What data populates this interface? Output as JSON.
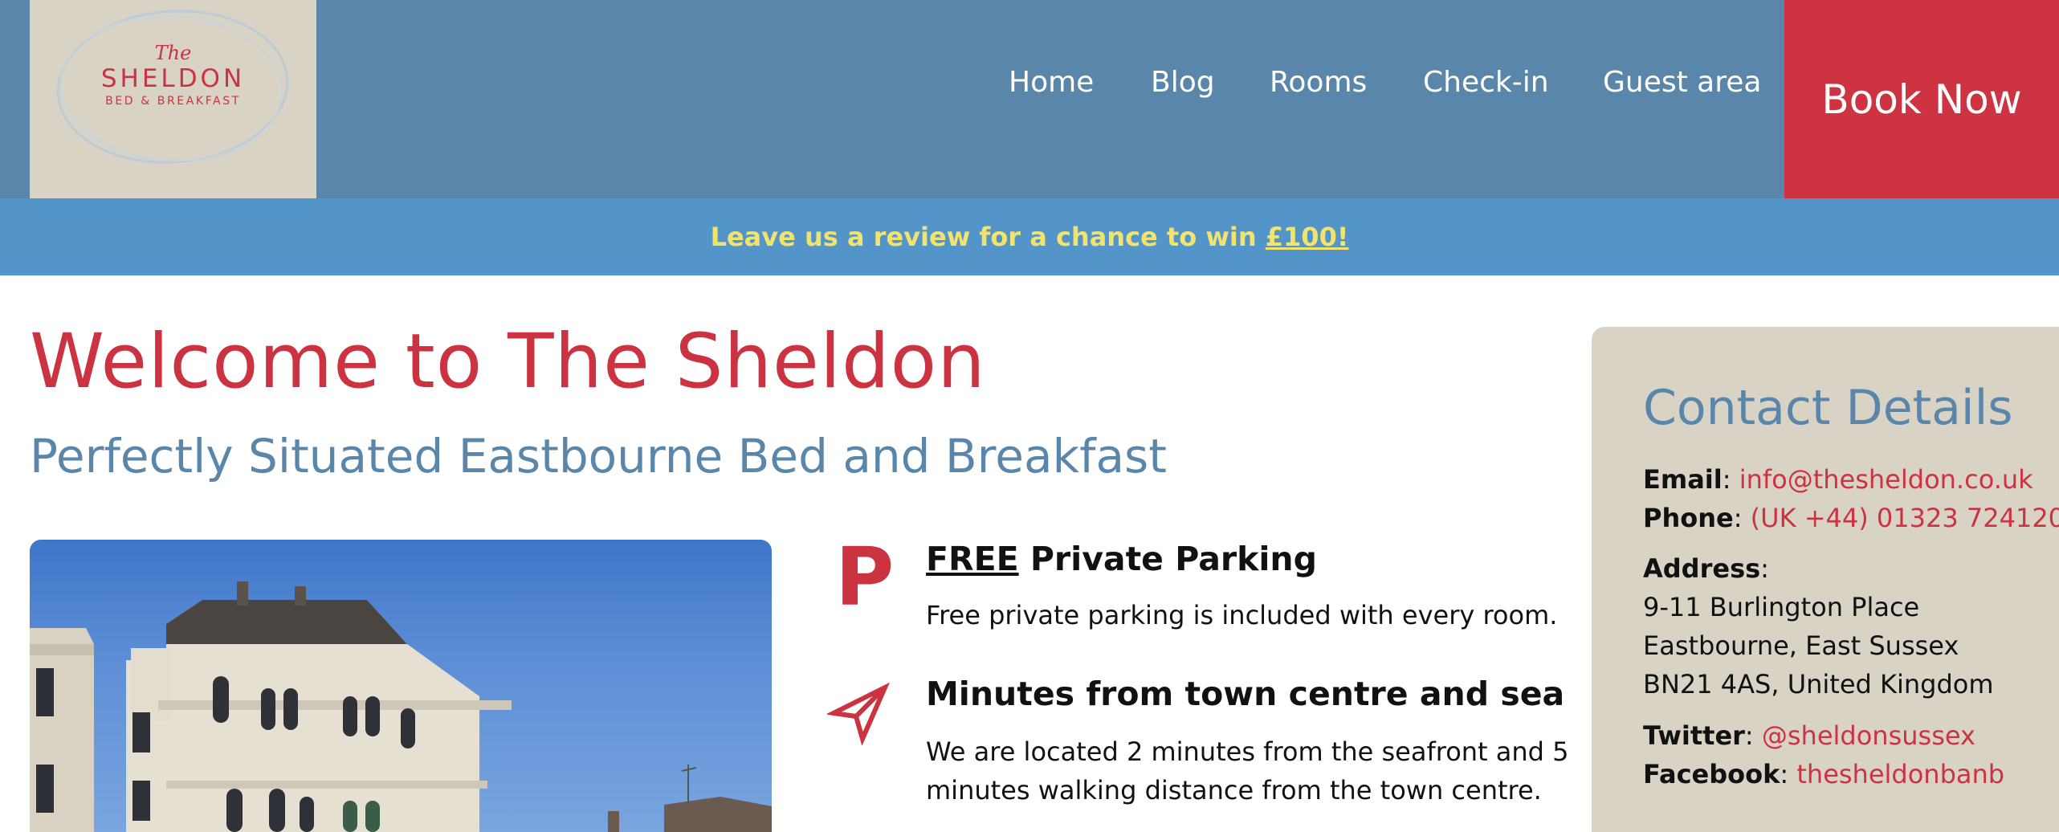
{
  "logo": {
    "the": "The",
    "name": "SHELDON",
    "sub": "BED & BREAKFAST"
  },
  "nav": {
    "items": [
      "Home",
      "Blog",
      "Rooms",
      "Check-in",
      "Guest area"
    ],
    "book_label": "Book Now"
  },
  "banner": {
    "text": "Leave us a review for a chance to win ",
    "link": "£100!"
  },
  "main": {
    "title": "Welcome to The Sheldon",
    "subtitle": "Perfectly Situated Eastbourne Bed and Breakfast",
    "features": [
      {
        "icon": "parking-icon",
        "icon_text": "P",
        "title_free": "FREE",
        "title_rest": " Private Parking",
        "text": "Free private parking is included with every room."
      },
      {
        "icon": "location-arrow-icon",
        "title": "Minutes from town centre and sea",
        "text": "We are located 2 minutes from the seafront and 5 minutes walking distance from the town centre."
      }
    ]
  },
  "contact": {
    "title": "Contact Details",
    "email_label": "Email",
    "email": "info@thesheldon.co.uk",
    "phone_label": "Phone",
    "phone": "(UK +44) 01323 724120",
    "address_label": "Address",
    "address_lines": [
      "9-11 Burlington Place",
      "Eastbourne, East Sussex",
      "BN21 4AS, United Kingdom"
    ],
    "twitter_label": "Twitter",
    "twitter": "@sheldonsussex",
    "facebook_label": "Facebook",
    "facebook": "thesheldonbanb"
  },
  "colors": {
    "header": "#5a86aa",
    "accent": "#cc3340",
    "banner": "#5395c8",
    "banner_text": "#f2e36c",
    "card": "#d8d3c4"
  }
}
